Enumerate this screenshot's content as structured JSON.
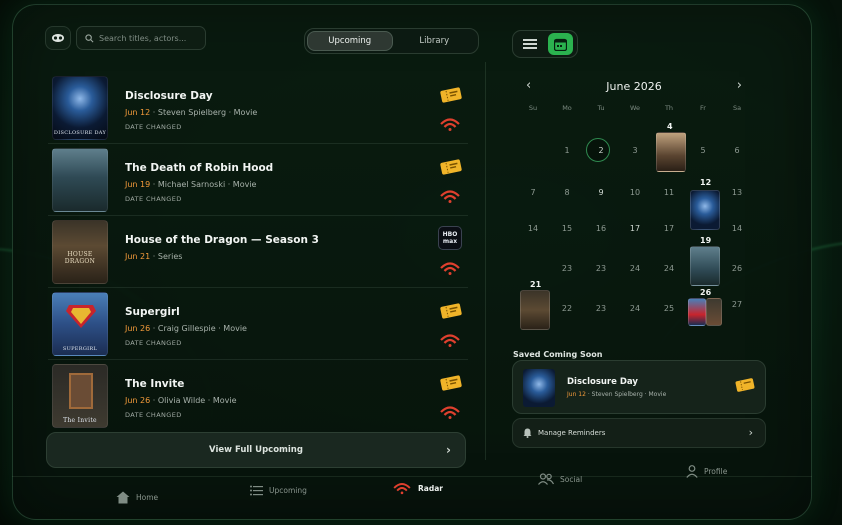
{
  "top": {
    "search_placeholder": "Search titles, actors...",
    "segments": [
      "Upcoming",
      "Library"
    ],
    "active_segment": "Upcoming"
  },
  "list": [
    {
      "title": "Disclosure Day",
      "date": "Jun 12",
      "meta": "· Steven Spielberg · Movie",
      "status": "DATE CHANGED",
      "provider": "ticket-icon",
      "poster_text": "DISCLOSURE DAY"
    },
    {
      "title": "The Death of Robin Hood",
      "date": "Jun 19",
      "meta": "· Michael Sarnoski · Movie",
      "status": "DATE CHANGED",
      "provider": "ticket-icon",
      "poster_text": ""
    },
    {
      "title": "House of the Dragon — Season 3",
      "date": "Jun 21",
      "meta": "· Series",
      "status": "",
      "provider": "hbo-max-logo",
      "poster_text": "HOUSE DRAGON"
    },
    {
      "title": "Supergirl",
      "date": "Jun 26",
      "meta": "· Craig Gillespie · Movie",
      "status": "DATE CHANGED",
      "provider": "ticket-icon",
      "poster_text": "SUPERGIRL"
    },
    {
      "title": "The Invite",
      "date": "Jun 26",
      "meta": "· Olivia Wilde · Movie",
      "status": "DATE CHANGED",
      "provider": "ticket-icon",
      "poster_text": "The Invite"
    }
  ],
  "hbo_label": [
    "HBO",
    "max"
  ],
  "view_full": "View Full Upcoming",
  "calendar": {
    "month": "June 2026",
    "dow": [
      "Su",
      "Mo",
      "Tu",
      "We",
      "Th",
      "Fr",
      "Sa"
    ],
    "today": "2",
    "marked": [
      "4",
      "12",
      "19",
      "21",
      "26"
    ]
  },
  "saved": {
    "label": "Saved Coming Soon",
    "title": "Disclosure Day",
    "date": "Jun 12",
    "meta": "· Steven Spielberg · Movie"
  },
  "reminders": "Manage Reminders",
  "tabs": [
    "Home",
    "Upcoming",
    "Radar",
    "Social",
    "Profile"
  ],
  "active_tab": "Radar",
  "colors": {
    "accent_green": "#2bb24f",
    "date_orange": "#f29a3a",
    "radar_red": "#e0402e",
    "ticket_gold": "#f0b429"
  }
}
